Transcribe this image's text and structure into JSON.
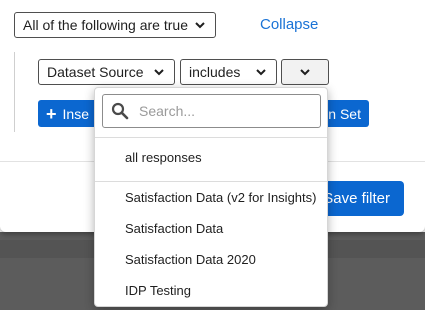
{
  "filter": {
    "match_select_value": "All of the following are true",
    "collapse_label": "Collapse",
    "condition": {
      "field_value": "Dataset Source",
      "operator_value": "includes",
      "value_value": ""
    },
    "insert_button_label": "Inse",
    "condition_set_button_label": "n Set",
    "save_filter_label": "Save filter"
  },
  "dropdown": {
    "search_placeholder": "Search...",
    "pinned_option": "all responses",
    "options": [
      "Satisfaction Data (v2 for Insights)",
      "Satisfaction Data",
      "Satisfaction Data 2020",
      "IDP Testing"
    ]
  },
  "colors": {
    "accent": "#0b67d0",
    "link": "#1a73d6",
    "backdrop": "#5c5c5c"
  }
}
